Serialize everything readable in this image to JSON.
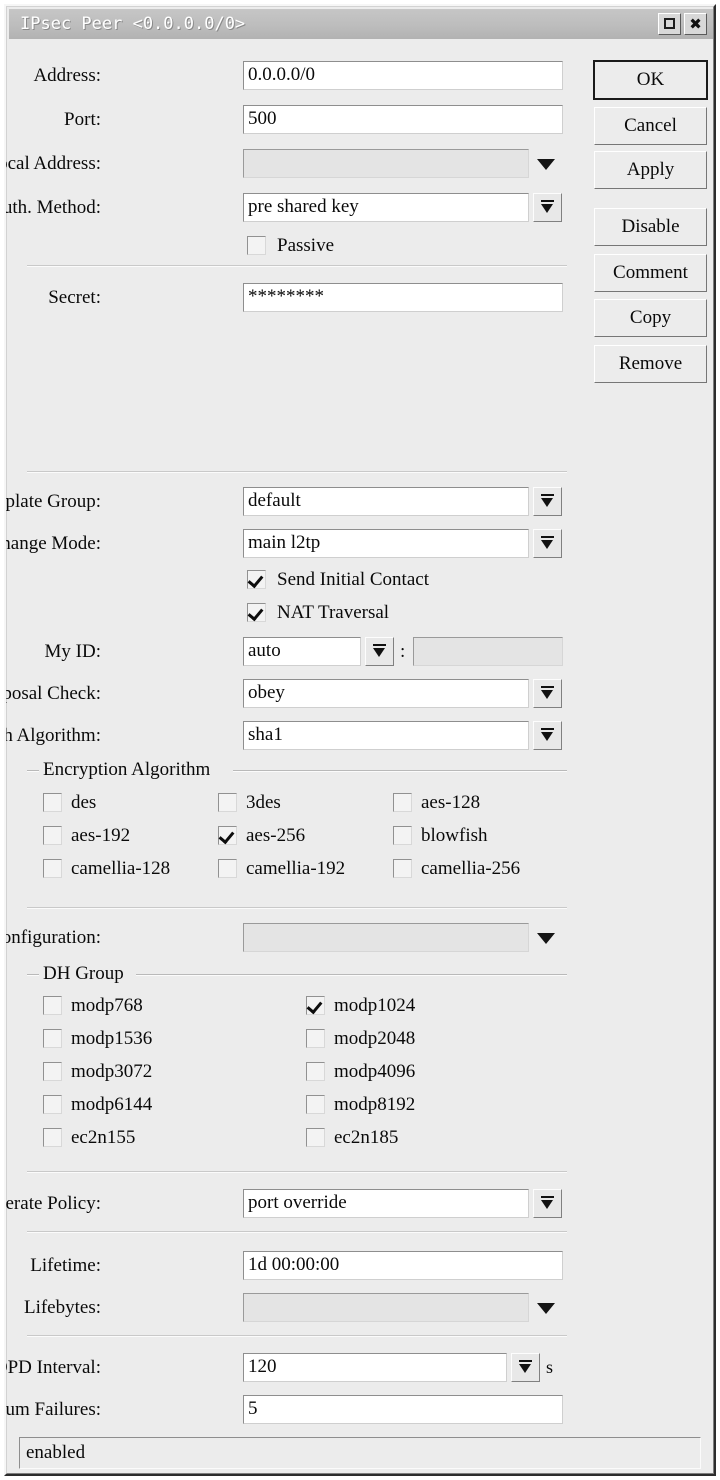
{
  "window": {
    "title": "IPsec Peer <0.0.0.0/0>",
    "restore_icon": "restore-icon",
    "close_icon": "close-icon",
    "close_glyph": "✖"
  },
  "buttons": [
    {
      "label": "OK",
      "name": "ok-button",
      "default": true
    },
    {
      "label": "Cancel",
      "name": "cancel-button",
      "default": false
    },
    {
      "label": "Apply",
      "name": "apply-button",
      "default": false
    },
    {
      "label": "Disable",
      "name": "disable-button",
      "default": false
    },
    {
      "label": "Comment",
      "name": "comment-button",
      "default": false
    },
    {
      "label": "Copy",
      "name": "copy-button",
      "default": false
    },
    {
      "label": "Remove",
      "name": "remove-button",
      "default": false
    }
  ],
  "fields": {
    "address": {
      "label": "Address:",
      "value": "0.0.0.0/0"
    },
    "port": {
      "label": "Port:",
      "value": "500"
    },
    "local_address": {
      "label": "Local Address:",
      "value": ""
    },
    "auth_method": {
      "label": "Auth. Method:",
      "value": "pre shared key"
    },
    "passive": {
      "label": "Passive",
      "checked": false
    },
    "secret": {
      "label": "Secret:",
      "value": "********"
    },
    "policy_template": {
      "label": "Policy Template Group:",
      "value": "default"
    },
    "exchange_mode": {
      "label": "Exchange Mode:",
      "value": "main l2tp"
    },
    "send_initial": {
      "label": "Send Initial Contact",
      "checked": true
    },
    "nat_traversal": {
      "label": "NAT Traversal",
      "checked": true
    },
    "my_id": {
      "label": "My ID:",
      "value": "auto",
      "separator": ":",
      "value2": ""
    },
    "proposal_check": {
      "label": "Proposal Check:",
      "value": "obey"
    },
    "hash_algorithm": {
      "label": "Hash Algorithm:",
      "value": "sha1"
    },
    "mode_configuration": {
      "label": "Mode Configuration:",
      "value": ""
    },
    "generate_policy": {
      "label": "Generate Policy:",
      "value": "port override"
    },
    "lifetime": {
      "label": "Lifetime:",
      "value": "1d 00:00:00"
    },
    "lifebytes": {
      "label": "Lifebytes:",
      "value": ""
    },
    "dpd_interval": {
      "label": "DPD Interval:",
      "value": "120",
      "suffix": "s"
    },
    "dpd_max_failures": {
      "label": "DPD Maximum Failures:",
      "value": "5"
    }
  },
  "encryption_algorithm": {
    "legend": "Encryption Algorithm",
    "items": [
      {
        "label": "des",
        "checked": false
      },
      {
        "label": "3des",
        "checked": false
      },
      {
        "label": "aes-128",
        "checked": false
      },
      {
        "label": "aes-192",
        "checked": false
      },
      {
        "label": "aes-256",
        "checked": true
      },
      {
        "label": "blowfish",
        "checked": false
      },
      {
        "label": "camellia-128",
        "checked": false
      },
      {
        "label": "camellia-192",
        "checked": false
      },
      {
        "label": "camellia-256",
        "checked": false
      }
    ]
  },
  "dh_group": {
    "legend": "DH Group",
    "items": [
      {
        "label": "modp768",
        "checked": false
      },
      {
        "label": "modp1024",
        "checked": true
      },
      {
        "label": "modp1536",
        "checked": false
      },
      {
        "label": "modp2048",
        "checked": false
      },
      {
        "label": "modp3072",
        "checked": false
      },
      {
        "label": "modp4096",
        "checked": false
      },
      {
        "label": "modp6144",
        "checked": false
      },
      {
        "label": "modp8192",
        "checked": false
      },
      {
        "label": "ec2n155",
        "checked": false
      },
      {
        "label": "ec2n185",
        "checked": false
      }
    ]
  },
  "statusbar": {
    "text": "enabled"
  }
}
